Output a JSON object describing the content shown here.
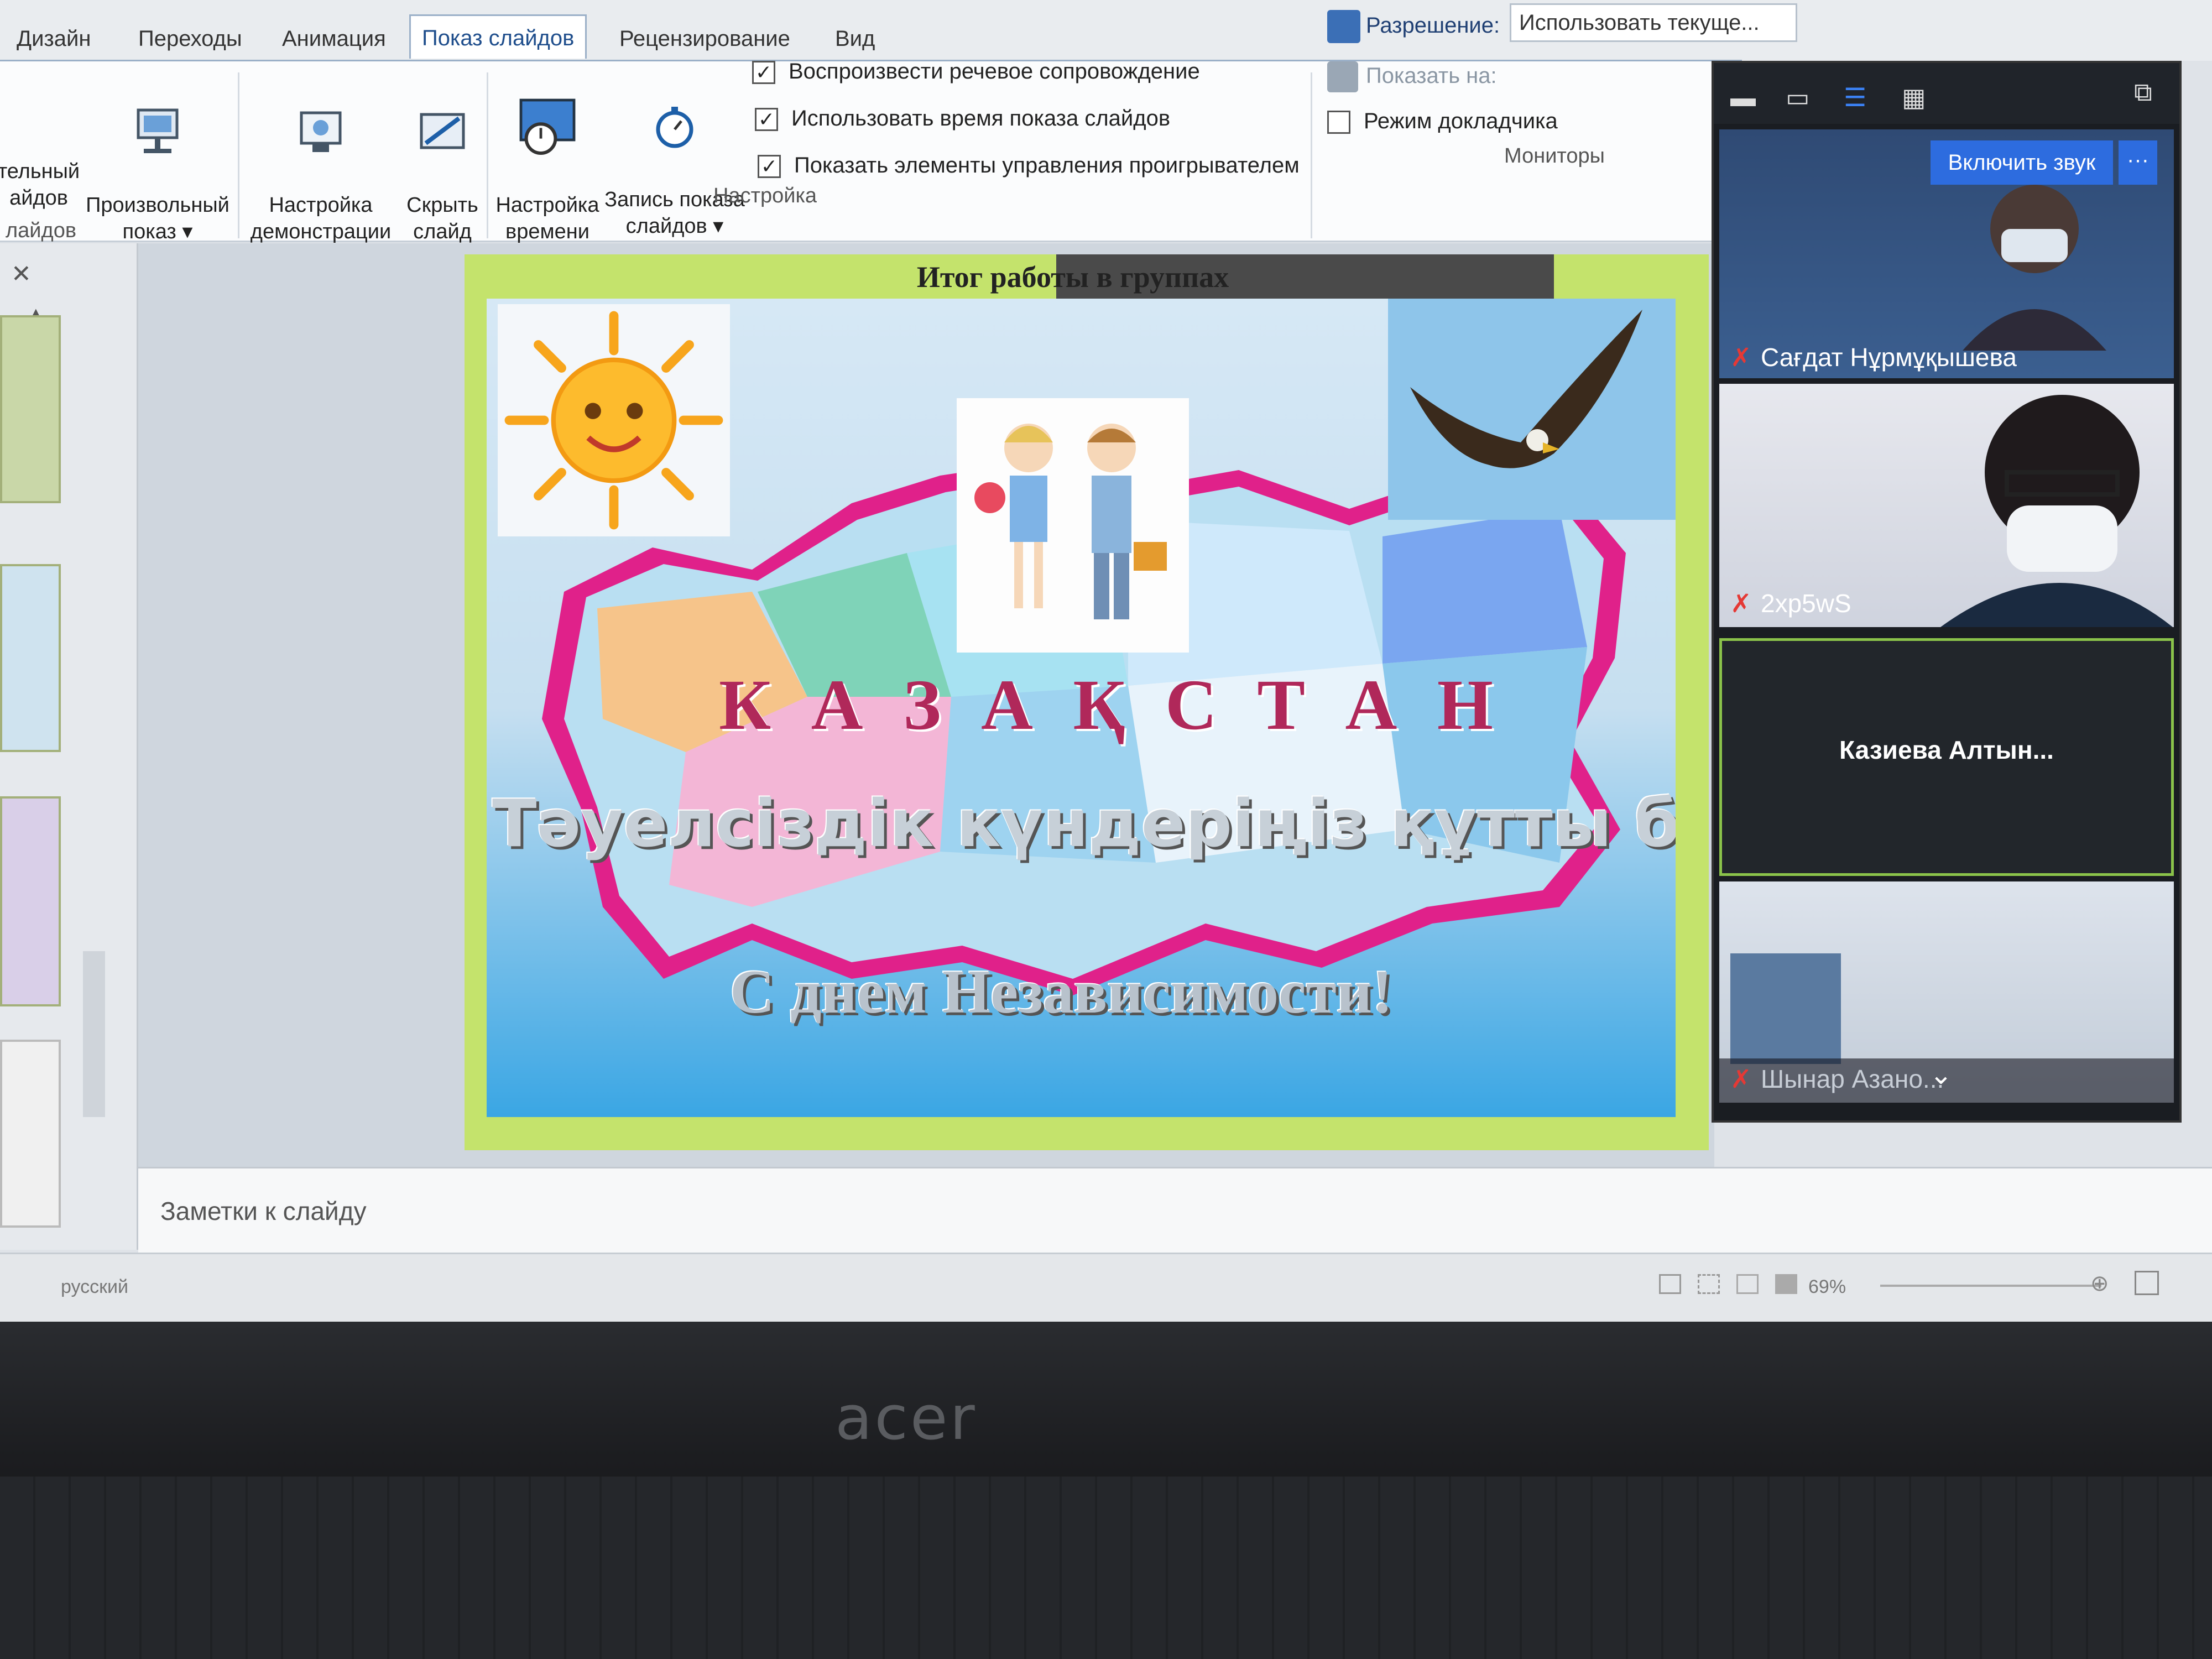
{
  "ribbon": {
    "tabs": [
      "Дизайн",
      "Переходы",
      "Анимация",
      "Показ слайдов",
      "Рецензирование",
      "Вид"
    ],
    "active_tab": "Показ слайдов",
    "buttons": {
      "from_start_partial": "тельный\nайдов",
      "custom_show": "Произвольный\nпоказ ▾",
      "setup_show": "Настройка\nдемонстрации",
      "hide_slide": "Скрыть\nслайд",
      "rehearse": "Настройка\nвремени",
      "record": "Запись показа\nслайдов ▾"
    },
    "checkboxes": [
      {
        "label": "Воспроизвести речевое сопровождение",
        "checked": true
      },
      {
        "label": "Использовать время показа слайдов",
        "checked": true
      },
      {
        "label": "Показать элементы управления проигрывателем",
        "checked": true
      }
    ],
    "group_setup": "Настройка",
    "group_left_partial": "лайдов",
    "resolution_label": "Разрешение:",
    "resolution_value": "Использовать текуще...",
    "show_on_label": "Показать на:",
    "presenter_view": "Режим докладчика",
    "group_monitors": "Мониторы"
  },
  "slide": {
    "title": "Итог работы в группах",
    "kz_letters": [
      "К",
      "А",
      "З",
      "А",
      "Қ",
      "С",
      "Т",
      "А",
      "Н"
    ],
    "congrats_kz": "Тәуелсіздік күндеріңіз құтты болсын",
    "congrats_ru": "С днем Независимости!"
  },
  "notes": {
    "placeholder": "Заметки к слайду"
  },
  "status": {
    "lang": "русский",
    "zoom": "69%"
  },
  "call": {
    "unmute_label": "Включить звук",
    "more_label": "···",
    "participants": [
      {
        "name": "Сағдат Нұрмұқышева",
        "muted": true
      },
      {
        "name": "2xp5wS",
        "muted": true
      },
      {
        "name": "Казиева Алтын...",
        "muted": false
      },
      {
        "name": "Шынар Азано...",
        "muted": true
      }
    ]
  },
  "laptop": {
    "brand": "acer"
  },
  "colors": {
    "slide_border": "#c4e36c",
    "map_pink": "#e0218a",
    "unmute_blue": "#2d6cdf"
  }
}
